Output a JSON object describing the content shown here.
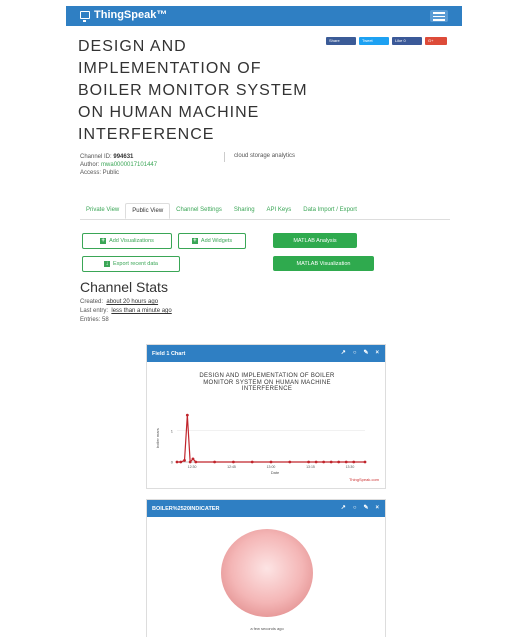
{
  "header": {
    "brand": "ThingSpeak™"
  },
  "share": [
    {
      "label": "Share",
      "color": "#3b5b97"
    },
    {
      "label": "Tweet",
      "color": "#1da1f2"
    },
    {
      "label": "Like 0",
      "color": "#3b5998"
    },
    {
      "label": "G+",
      "color": "#dd4b39"
    }
  ],
  "channel": {
    "title": "DESIGN AND IMPLEMENTATION OF BOILER MONITOR SYSTEM ON HUMAN MACHINE INTERFERENCE",
    "id_label": "Channel ID:",
    "id_value": "994631",
    "author_label": "Author:",
    "author_value": "mwa0000017101447",
    "access": "Access: Public",
    "tag": "cloud storage analytics"
  },
  "tabs": [
    "Private View",
    "Public View",
    "Channel Settings",
    "Sharing",
    "API Keys",
    "Data Import / Export"
  ],
  "buttons": {
    "add_visualizations": "Add Visualizations",
    "add_widgets": "Add Widgets",
    "export_data": "Export recent data",
    "matlab_analysis": "MATLAB Analysis",
    "matlab_visualization": "MATLAB Visualization"
  },
  "stats": {
    "heading": "Channel Stats",
    "created_label": "Created:",
    "created_value": "about 20 hours ago",
    "last_entry_label": "Last entry:",
    "last_entry_value": "less than a minute ago",
    "entries": "Entries: 58"
  },
  "field_chart": {
    "header": "Field 1 Chart",
    "title_line1": "DESIGN AND IMPLEMENTATION OF BOILER",
    "title_line2": "MONITOR SYSTEM ON HUMAN MACHINE",
    "title_line3": "INTERFERENCE",
    "ylabel": "boiler mars",
    "xlabel": "Date",
    "credit": "ThingSpeak.com"
  },
  "chart_data": {
    "type": "line",
    "title": "DESIGN AND IMPLEMENTATION OF BOILER MONITOR SYSTEM ON HUMAN MACHINE INTERFERENCE",
    "xlabel": "Date",
    "ylabel": "boiler mars",
    "x_ticks": [
      "12:30",
      "12:45",
      "13:00",
      "13:15",
      "13:30"
    ],
    "y_ticks": [
      "0",
      "1"
    ],
    "ylim": [
      0,
      1.6
    ],
    "grid": true,
    "series": [
      {
        "color": "#c0242b",
        "x": [
          0,
          0.02,
          0.04,
          0.055,
          0.07,
          0.085,
          0.1,
          0.2,
          0.3,
          0.4,
          0.5,
          0.6,
          0.7,
          0.74,
          0.78,
          0.82,
          0.86,
          0.9,
          0.94,
          1.0
        ],
        "y": [
          0,
          0,
          0.05,
          1.5,
          0,
          0.1,
          0,
          0,
          0,
          0,
          0,
          0,
          0,
          0,
          0,
          0,
          0,
          0,
          0,
          0
        ]
      }
    ]
  },
  "gauge": {
    "header": "BOILER%2520INDICATER",
    "caption": "a few seconds ago",
    "color": "#f4b6b6"
  }
}
